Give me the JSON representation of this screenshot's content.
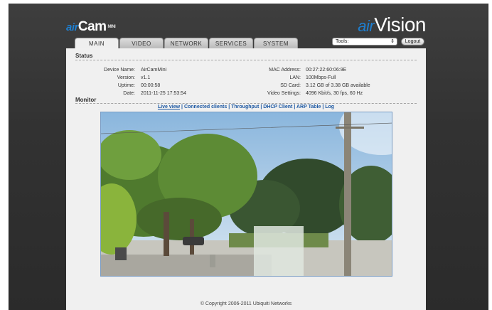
{
  "brand": {
    "left_prefix": "air",
    "left_name": "Cam",
    "left_suffix": "MINI",
    "right_prefix": "air",
    "right_name": "Vision"
  },
  "tabs": [
    {
      "label": "MAIN"
    },
    {
      "label": "VIDEO"
    },
    {
      "label": "NETWORK"
    },
    {
      "label": "SERVICES"
    },
    {
      "label": "SYSTEM"
    }
  ],
  "tools": {
    "selected": "Tools:",
    "arrow": "⇕"
  },
  "logout_label": "Logout",
  "status": {
    "title": "Status",
    "left": [
      {
        "label": "Device Name:",
        "value": "AirCamMini"
      },
      {
        "label": "Version:",
        "value": "v1.1"
      },
      {
        "label": "Uptime:",
        "value": "00:00:58"
      },
      {
        "label": "Date:",
        "value": "2011-11-25 17:53:54"
      }
    ],
    "right": [
      {
        "label": "MAC Address:",
        "value": "00:27:22:60:06:9E"
      },
      {
        "label": "LAN:",
        "value": "100Mbps-Full"
      },
      {
        "label": "SD Card:",
        "value": "3.12 GB of 3.38 GB available"
      },
      {
        "label": "Video Settings:",
        "value": "4096 Kbit/s, 30 fps, 60 Hz"
      }
    ]
  },
  "monitor": {
    "title": "Monitor",
    "links": [
      "Live view",
      "Connected clients",
      "Throughput",
      "DHCP Client",
      "ARP Table",
      "Log"
    ],
    "separator": "|"
  },
  "footer": "© Copyright 2006-2011 Ubiquiti Networks",
  "colors": {
    "accent": "#1e7fd0",
    "link": "#1c58a3",
    "panel": "#f0f0f0",
    "frame": "#333333"
  }
}
